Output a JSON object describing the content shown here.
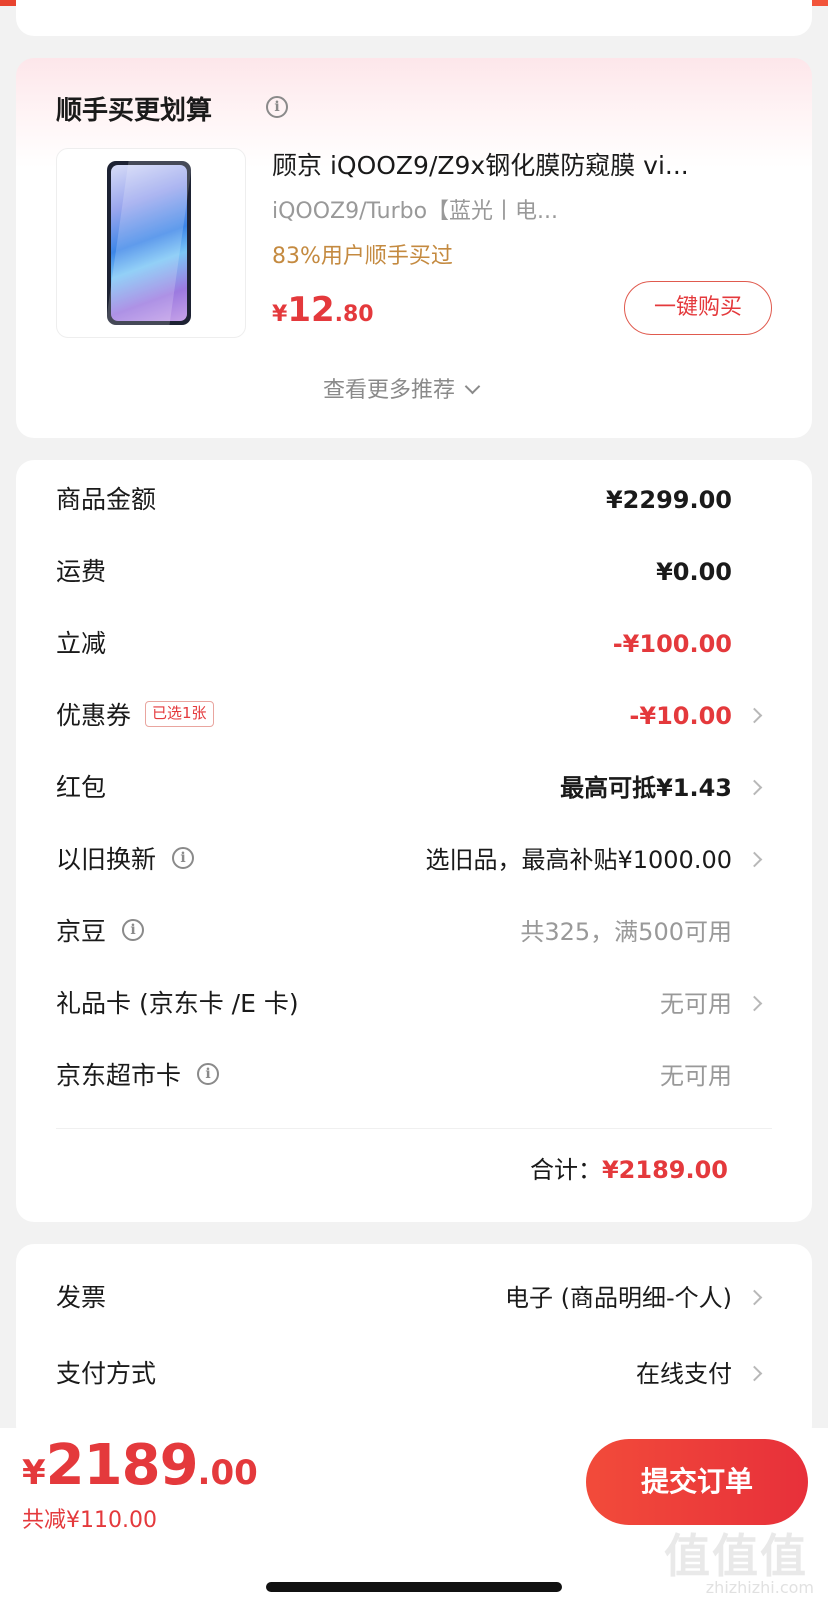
{
  "recommend": {
    "title": "顺手买更划算",
    "product": {
      "title": "顾京  iQOOZ9/Z9x钢化膜防窥膜 vi...",
      "subtitle": "iQOOZ9/Turbo【蓝光丨电...",
      "bought": "83%用户顺手买过",
      "price_currency": "¥",
      "price_int": "12",
      "price_dec": ".80",
      "buy_label": "一键购买"
    },
    "more_label": "查看更多推荐"
  },
  "summary": {
    "rows": [
      {
        "label": "商品金额",
        "value": "¥2299.00"
      },
      {
        "label": "运费",
        "value": "¥0.00"
      },
      {
        "label": "立减",
        "value": "-¥100.00"
      },
      {
        "label": "优惠券",
        "tag": "已选1张",
        "value": "-¥10.00"
      },
      {
        "label": "红包",
        "value": "最高可抵¥1.43"
      },
      {
        "label": "以旧换新",
        "value": "选旧品，最高补贴¥1000.00"
      },
      {
        "label": "京豆",
        "value": "共325，满500可用"
      },
      {
        "label": "礼品卡 (京东卡 /E 卡)",
        "value": "无可用"
      },
      {
        "label": "京东超市卡",
        "value": "无可用"
      }
    ],
    "total_label": "合计：",
    "total_value": "¥2189.00"
  },
  "invoice": {
    "rows": [
      {
        "label": "发票",
        "value": "电子 (商品明细-个人)"
      },
      {
        "label": "支付方式",
        "value": "在线支付"
      }
    ]
  },
  "bottom": {
    "price_currency": "¥",
    "price_int": "2189",
    "price_dec": ".00",
    "saved": "共减¥110.00",
    "submit_label": "提交订单"
  },
  "watermark": {
    "glyphs": "值值值",
    "url": "zhizhizhi.com"
  },
  "colors": {
    "accent_red": "#e4393c",
    "gold": "#c48a40",
    "grey_text": "#999999"
  },
  "icons": {
    "info": "info-circle-icon",
    "chevron_right": "chevron-right-icon",
    "chevron_down": "chevron-down-icon"
  }
}
